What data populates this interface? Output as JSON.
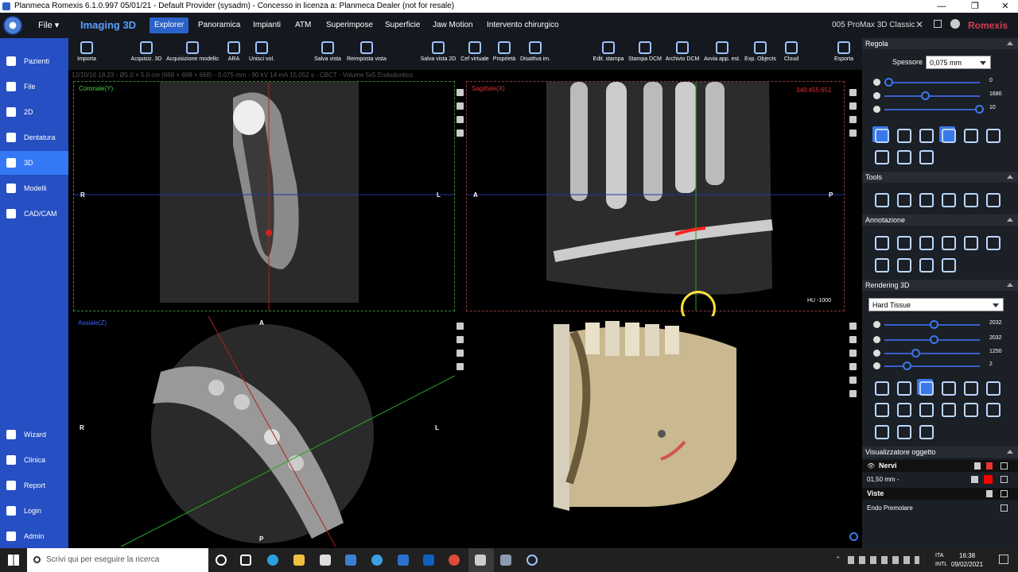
{
  "window": {
    "title": "Planmeca Romexis 6.1.0.997 05/01/21 - Default Provider (sysadm) - Concesso in licenza a: Planmeca Dealer (not for resale)"
  },
  "menubar": {
    "file": "File",
    "module": "Imaging 3D",
    "tabs": [
      "Explorer",
      "Panoramica",
      "Impianti",
      "ATM",
      "Superimpose",
      "Superficie",
      "Jaw Motion",
      "Intervento chirurgico"
    ],
    "device": "005 ProMax 3D Classic",
    "brand": "Romexis"
  },
  "sidebar": {
    "top": [
      "Pazienti",
      "File",
      "2D",
      "Dentatura",
      "3D",
      "Modelli",
      "CAD/CAM"
    ],
    "bottom": [
      "Wizard",
      "Clinica",
      "Report",
      "Login",
      "Admin"
    ]
  },
  "toolbar": {
    "buttons": [
      "Importa",
      "Acquisiz. 3D",
      "Acquisizione modello",
      "ARA",
      "Unisci vol.",
      "Salva vista",
      "Reimposta vista",
      "Salva vista 2D",
      "Cef virtuale",
      "Proprietà",
      "Disattiva im.",
      "Edit. stampa",
      "Stampa DCM",
      "Archivio DCM",
      "Avvia app. est.",
      "Exp. Objects",
      "Cloud",
      "Esporta"
    ]
  },
  "volume_info": "12/10/16 18.23 - Ø5.0 × 5.0 cm (668 × 668 × 668) - 0.075 mm - 90 kV 14 mA 15.052 s - CBCT - Volume 5x5 Endodontico",
  "panes": {
    "coronal": {
      "title": "Coronale(Y)",
      "left": "R",
      "right": "L"
    },
    "sagittal": {
      "title": "Sagittale(X)",
      "left": "A",
      "right": "P",
      "coords": "348:455:651",
      "hu": "HU -1000"
    },
    "axial": {
      "title": "Assiale(Z)",
      "left": "R",
      "right": "L",
      "top": "A",
      "bottom": "P"
    }
  },
  "right_panel": {
    "regola": {
      "title": "Regola",
      "spessore_label": "Spessore",
      "spessore_value": "0,075 mm",
      "sliders": [
        {
          "value": "0",
          "level": 0.0
        },
        {
          "value": "1680",
          "level": 0.4
        },
        {
          "value": "10",
          "level": 1.0
        }
      ]
    },
    "tools_title": "Tools",
    "annotazione_title": "Annotazione",
    "rendering": {
      "title": "Rendering 3D",
      "preset": "Hard Tissue",
      "sliders": [
        {
          "value": "2032",
          "level": 0.5
        },
        {
          "value": "2032",
          "level": 0.5
        },
        {
          "value": "1250",
          "level": 0.3
        },
        {
          "value": "2",
          "level": 0.2
        }
      ]
    },
    "visualizzatore": {
      "title": "Visualizzatore oggetto",
      "nervi_label": "Nervi",
      "nervi_value": "01,50 mm -",
      "viste_label": "Viste",
      "viste_item": "Endo Premolare"
    }
  },
  "taskbar": {
    "search_placeholder": "Scrivi qui per eseguire la ricerca",
    "lang_top": "ITA",
    "lang_bottom": "INTL",
    "time": "16:38",
    "date": "09/02/2021"
  },
  "colors": {
    "accent": "#2a62c9",
    "sidebar": "#254fc3",
    "brand": "#d93b55",
    "coronal": "#4bd04b",
    "sagittal": "#e03030",
    "axial": "#3a5fff"
  }
}
